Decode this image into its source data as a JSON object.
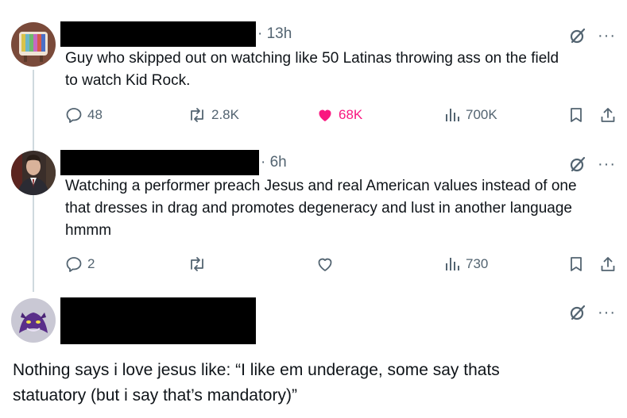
{
  "colors": {
    "text": "#0f1419",
    "muted": "#536471",
    "like": "#f91880",
    "thread": "#cfd9de"
  },
  "tweets": [
    {
      "time": "· 13h",
      "text_line1": "Guy who skipped out on watching like 50 Latinas throwing ass on the field",
      "text_line2": "to watch Kid Rock.",
      "replies": "48",
      "reposts": "2.8K",
      "likes": "68K",
      "views": "700K",
      "liked": true
    },
    {
      "time": "· 6h",
      "text_line1": "Watching a performer preach Jesus and real American values instead of one",
      "text_line2": "that dresses in drag and promotes degeneracy and lust in another language",
      "text_line3": "hmmm",
      "replies": "2",
      "reposts": "",
      "likes": "",
      "views": "730",
      "liked": false
    },
    {
      "text_line1": "Nothing says i love jesus like: “I like em underage, some say thats",
      "text_line2": "statuatory (but i say that’s mandatory)”"
    }
  ],
  "menu_glyph": "···",
  "icons": [
    "grok-icon",
    "more-icon",
    "reply-icon",
    "repost-icon",
    "like-icon",
    "views-icon",
    "bookmark-icon",
    "share-icon"
  ]
}
